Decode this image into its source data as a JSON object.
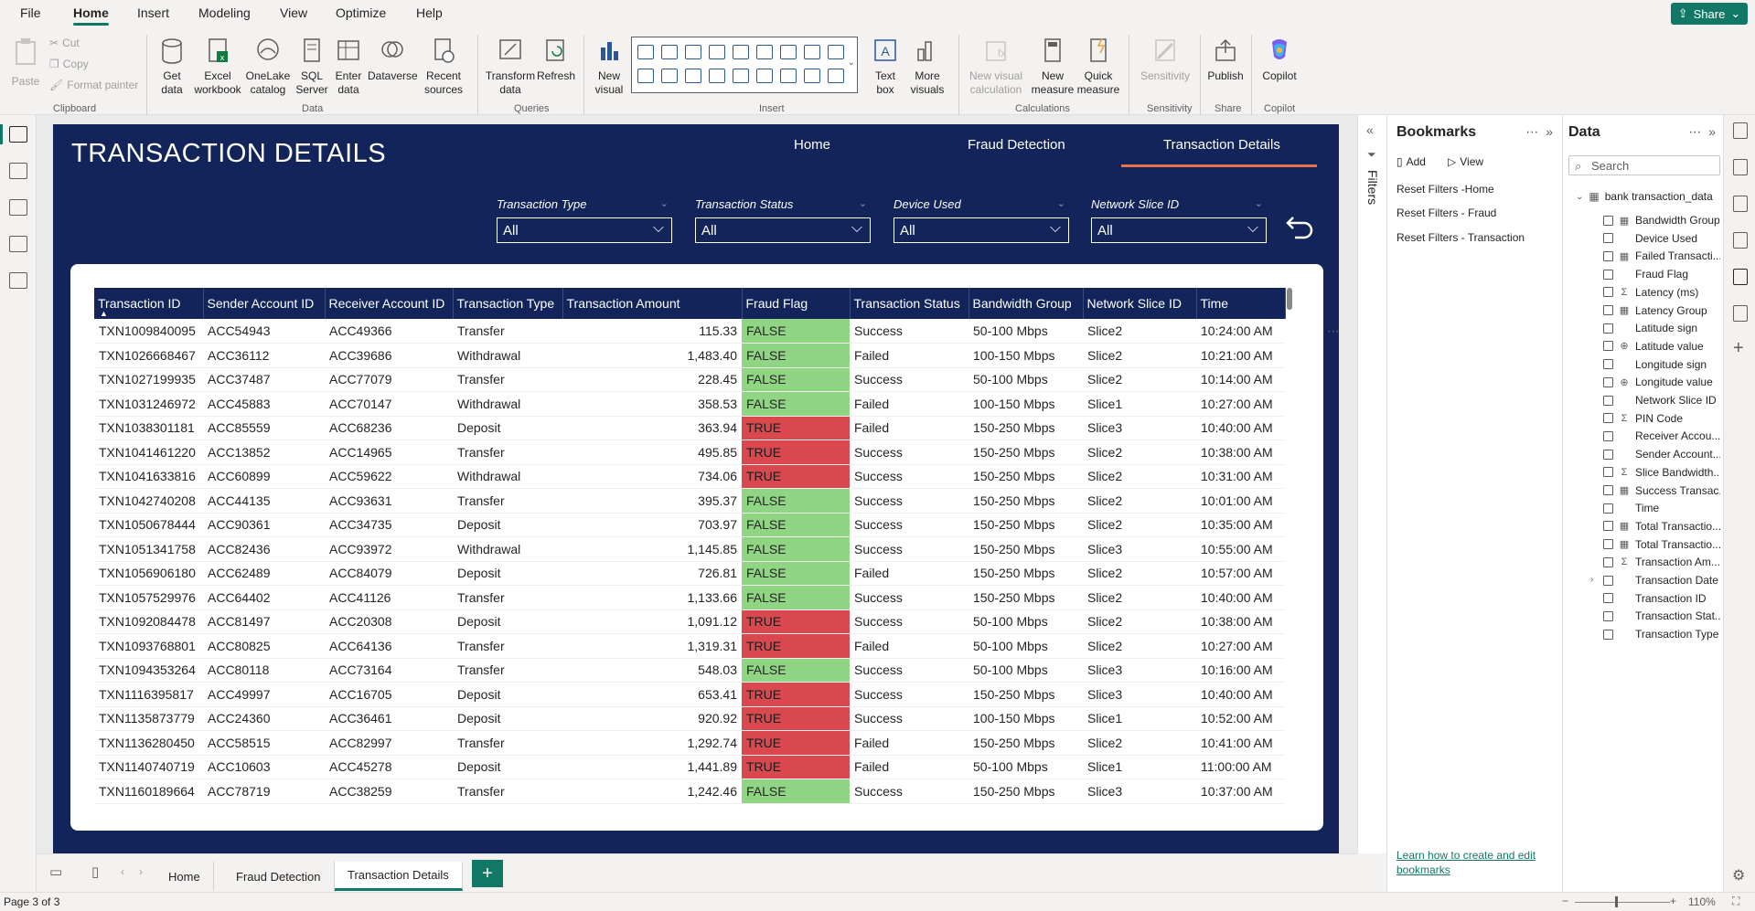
{
  "menu": [
    "File",
    "Home",
    "Insert",
    "Modeling",
    "View",
    "Optimize",
    "Help"
  ],
  "share_label": "Share",
  "ribbon": {
    "clipboard": {
      "paste": "Paste",
      "cut": "Cut",
      "copy": "Copy",
      "format_painter": "Format painter",
      "group": "Clipboard"
    },
    "data": {
      "get_data": "Get data",
      "excel": "Excel workbook",
      "onelake": "OneLake catalog",
      "sql": "SQL Server",
      "enter": "Enter data",
      "dataverse": "Dataverse",
      "recent": "Recent sources",
      "group": "Data"
    },
    "queries": {
      "transform": "Transform data",
      "refresh": "Refresh",
      "group": "Queries"
    },
    "insert": {
      "new_visual": "New visual",
      "text_box": "Text box",
      "more_visuals": "More visuals",
      "group": "Insert"
    },
    "calculations": {
      "new_visual_calc": "New visual calculation",
      "new_measure": "New measure",
      "quick_measure": "Quick measure",
      "group": "Calculations"
    },
    "sensitivity": {
      "label": "Sensitivity",
      "group": "Sensitivity"
    },
    "share": {
      "publish": "Publish",
      "group": "Share"
    },
    "copilot": {
      "label": "Copilot",
      "group": "Copilot"
    }
  },
  "report": {
    "title": "TRANSACTION DETAILS",
    "nav": [
      "Home",
      "Fraud Detection",
      "Transaction Details"
    ],
    "slicers": [
      {
        "label": "Transaction Type",
        "value": "All"
      },
      {
        "label": "Transaction Status",
        "value": "All"
      },
      {
        "label": "Device Used",
        "value": "All"
      },
      {
        "label": "Network Slice ID",
        "value": "All"
      }
    ],
    "table": {
      "columns": [
        "Transaction ID",
        "Sender Account ID",
        "Receiver Account ID",
        "Transaction Type",
        "Transaction Amount",
        "Fraud Flag",
        "Transaction Status",
        "Bandwidth Group",
        "Network Slice ID",
        "Time"
      ],
      "rows": [
        [
          "TXN1009840095",
          "ACC54943",
          "ACC49366",
          "Transfer",
          "115.33",
          "FALSE",
          "Success",
          "50-100 Mbps",
          "Slice2",
          "10:24:00 AM"
        ],
        [
          "TXN1026668467",
          "ACC36112",
          "ACC39686",
          "Withdrawal",
          "1,483.40",
          "FALSE",
          "Failed",
          "100-150 Mbps",
          "Slice2",
          "10:21:00 AM"
        ],
        [
          "TXN1027199935",
          "ACC37487",
          "ACC77079",
          "Transfer",
          "228.45",
          "FALSE",
          "Success",
          "50-100 Mbps",
          "Slice2",
          "10:14:00 AM"
        ],
        [
          "TXN1031246972",
          "ACC45883",
          "ACC70147",
          "Withdrawal",
          "358.53",
          "FALSE",
          "Failed",
          "100-150 Mbps",
          "Slice1",
          "10:27:00 AM"
        ],
        [
          "TXN1038301181",
          "ACC85559",
          "ACC68236",
          "Deposit",
          "363.94",
          "TRUE",
          "Failed",
          "150-250 Mbps",
          "Slice3",
          "10:40:00 AM"
        ],
        [
          "TXN1041461220",
          "ACC13852",
          "ACC14965",
          "Transfer",
          "495.85",
          "TRUE",
          "Success",
          "150-250 Mbps",
          "Slice2",
          "10:38:00 AM"
        ],
        [
          "TXN1041633816",
          "ACC60899",
          "ACC59622",
          "Withdrawal",
          "734.06",
          "TRUE",
          "Success",
          "150-250 Mbps",
          "Slice2",
          "10:31:00 AM"
        ],
        [
          "TXN1042740208",
          "ACC44135",
          "ACC93631",
          "Transfer",
          "395.37",
          "FALSE",
          "Success",
          "150-250 Mbps",
          "Slice2",
          "10:01:00 AM"
        ],
        [
          "TXN1050678444",
          "ACC90361",
          "ACC34735",
          "Deposit",
          "703.97",
          "FALSE",
          "Success",
          "150-250 Mbps",
          "Slice2",
          "10:35:00 AM"
        ],
        [
          "TXN1051341758",
          "ACC82436",
          "ACC93972",
          "Withdrawal",
          "1,145.85",
          "FALSE",
          "Success",
          "150-250 Mbps",
          "Slice3",
          "10:55:00 AM"
        ],
        [
          "TXN1056906180",
          "ACC62489",
          "ACC84079",
          "Deposit",
          "726.81",
          "FALSE",
          "Failed",
          "150-250 Mbps",
          "Slice2",
          "10:57:00 AM"
        ],
        [
          "TXN1057529976",
          "ACC64402",
          "ACC41126",
          "Transfer",
          "1,133.66",
          "FALSE",
          "Success",
          "150-250 Mbps",
          "Slice2",
          "10:40:00 AM"
        ],
        [
          "TXN1092084478",
          "ACC81497",
          "ACC20308",
          "Deposit",
          "1,091.12",
          "TRUE",
          "Success",
          "50-100 Mbps",
          "Slice2",
          "10:38:00 AM"
        ],
        [
          "TXN1093768801",
          "ACC80825",
          "ACC64136",
          "Transfer",
          "1,319.31",
          "TRUE",
          "Failed",
          "50-100 Mbps",
          "Slice2",
          "10:27:00 AM"
        ],
        [
          "TXN1094353264",
          "ACC80118",
          "ACC73164",
          "Transfer",
          "548.03",
          "FALSE",
          "Success",
          "50-100 Mbps",
          "Slice3",
          "10:16:00 AM"
        ],
        [
          "TXN1116395817",
          "ACC49997",
          "ACC16705",
          "Deposit",
          "653.41",
          "TRUE",
          "Success",
          "150-250 Mbps",
          "Slice3",
          "10:40:00 AM"
        ],
        [
          "TXN1135873779",
          "ACC24360",
          "ACC36461",
          "Deposit",
          "920.92",
          "TRUE",
          "Success",
          "100-150 Mbps",
          "Slice1",
          "10:52:00 AM"
        ],
        [
          "TXN1136280450",
          "ACC58515",
          "ACC82997",
          "Transfer",
          "1,292.74",
          "TRUE",
          "Failed",
          "150-250 Mbps",
          "Slice2",
          "10:41:00 AM"
        ],
        [
          "TXN1140740719",
          "ACC10603",
          "ACC45278",
          "Deposit",
          "1,441.89",
          "TRUE",
          "Failed",
          "50-100 Mbps",
          "Slice1",
          "11:00:00 AM"
        ],
        [
          "TXN1160189664",
          "ACC78719",
          "ACC38259",
          "Transfer",
          "1,242.46",
          "FALSE",
          "Success",
          "150-250 Mbps",
          "Slice3",
          "10:37:00 AM"
        ]
      ]
    }
  },
  "filters_label": "Filters",
  "bookmarks": {
    "title": "Bookmarks",
    "add": "Add",
    "view": "View",
    "items": [
      "Reset Filters -Home",
      "Reset Filters - Fraud",
      "Reset Filters - Transaction"
    ],
    "learn_link": "Learn how to create and edit bookmarks"
  },
  "data_pane": {
    "title": "Data",
    "search_placeholder": "Search",
    "table_name": "bank transaction_data",
    "fields": [
      {
        "name": "Bandwidth Group",
        "icon": "calc-column-icon"
      },
      {
        "name": "Device Used",
        "icon": ""
      },
      {
        "name": "Failed Transacti...",
        "icon": "measure-table-icon"
      },
      {
        "name": "Fraud Flag",
        "icon": ""
      },
      {
        "name": "Latency (ms)",
        "icon": "sigma-icon"
      },
      {
        "name": "Latency Group",
        "icon": "calc-column-icon"
      },
      {
        "name": "Latitude sign",
        "icon": ""
      },
      {
        "name": "Latitude value",
        "icon": "globe-icon"
      },
      {
        "name": "Longitude sign",
        "icon": ""
      },
      {
        "name": "Longitude value",
        "icon": "globe-icon"
      },
      {
        "name": "Network Slice ID",
        "icon": ""
      },
      {
        "name": "PIN Code",
        "icon": "sigma-icon"
      },
      {
        "name": "Receiver Accou...",
        "icon": ""
      },
      {
        "name": "Sender Account...",
        "icon": ""
      },
      {
        "name": "Slice Bandwidth...",
        "icon": "sigma-icon"
      },
      {
        "name": "Success Transac...",
        "icon": "measure-table-icon"
      },
      {
        "name": "Time",
        "icon": ""
      },
      {
        "name": "Total Transactio...",
        "icon": "measure-table-icon"
      },
      {
        "name": "Total Transactio...",
        "icon": "measure-table-icon"
      },
      {
        "name": "Transaction Am...",
        "icon": "sigma-icon"
      },
      {
        "name": "Transaction Date",
        "icon": ""
      },
      {
        "name": "Transaction ID",
        "icon": ""
      },
      {
        "name": "Transaction Stat...",
        "icon": ""
      },
      {
        "name": "Transaction Type",
        "icon": ""
      }
    ]
  },
  "page_tabs": [
    "Home",
    "Fraud Detection",
    "Transaction Details"
  ],
  "status": {
    "page": "Page 3 of 3",
    "zoom": "110%"
  },
  "colors": {
    "accent": "#117865",
    "report_bg": "#12245a",
    "fraud_true": "#d9484f",
    "fraud_false": "#8fd584",
    "nav_underline": "#e8734a"
  }
}
